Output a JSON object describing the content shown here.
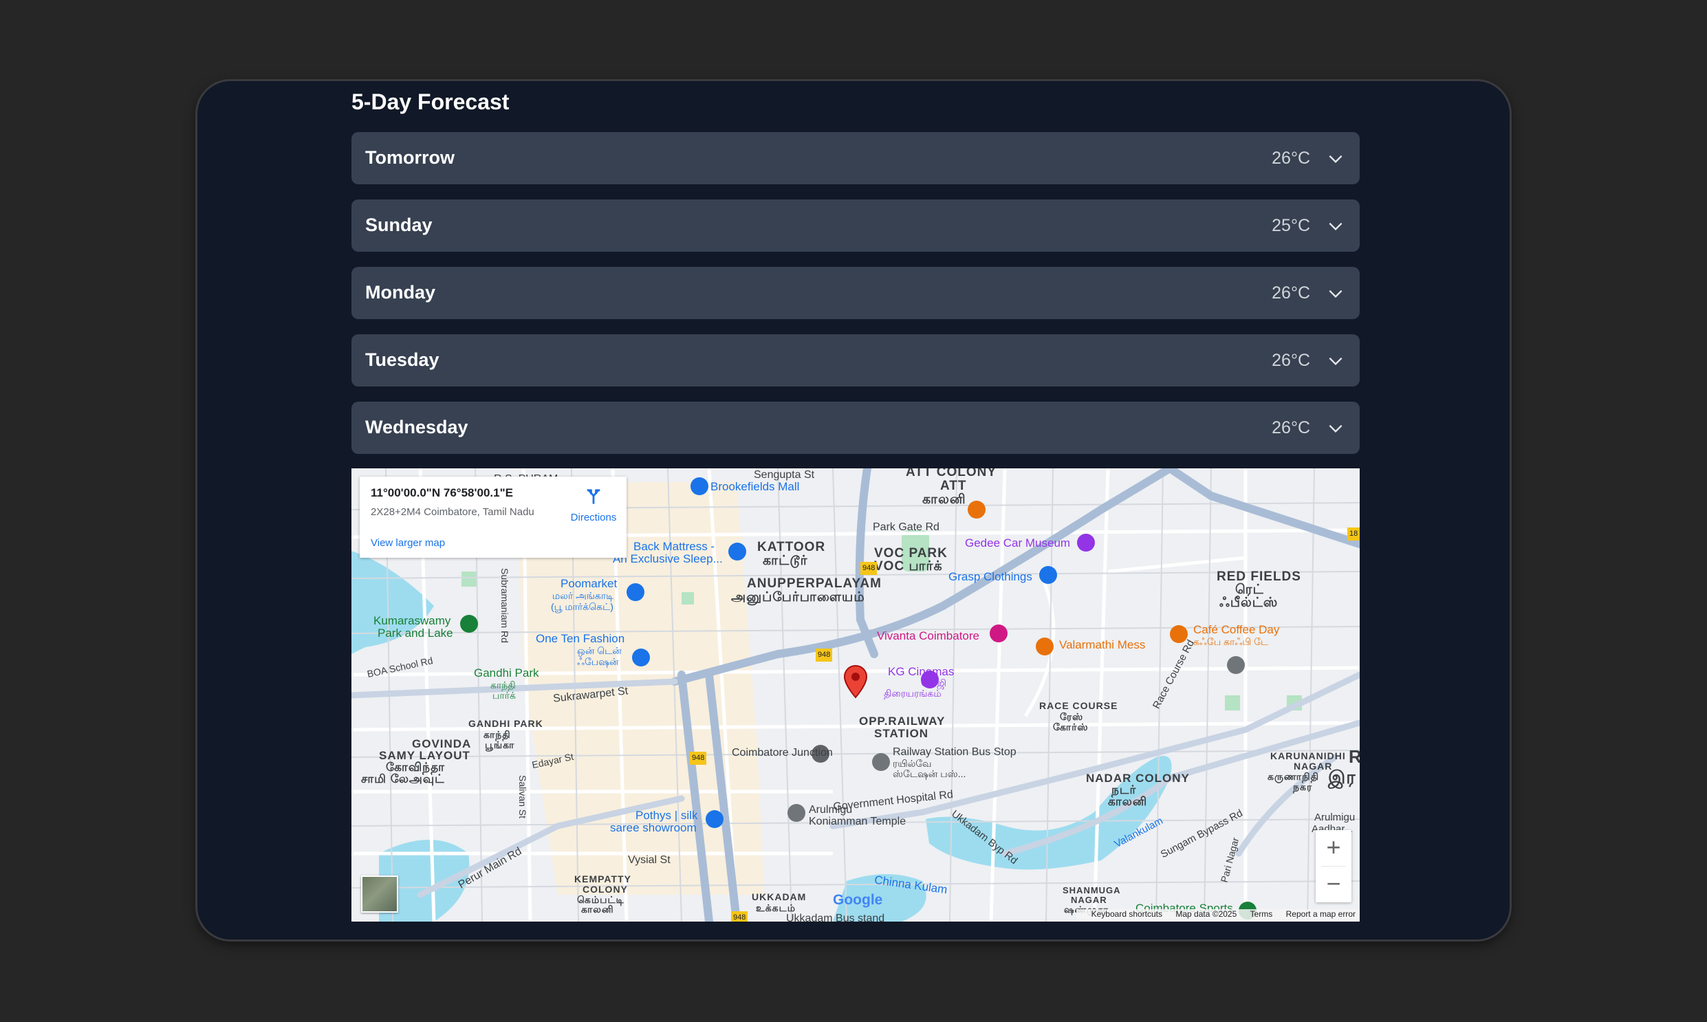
{
  "forecast": {
    "title": "5-Day Forecast",
    "days": [
      {
        "name": "Tomorrow",
        "temp": "26°C"
      },
      {
        "name": "Sunday",
        "temp": "25°C"
      },
      {
        "name": "Monday",
        "temp": "26°C"
      },
      {
        "name": "Tuesday",
        "temp": "26°C"
      },
      {
        "name": "Wednesday",
        "temp": "26°C"
      }
    ]
  },
  "map": {
    "info": {
      "coords": "11°00'00.0\"N 76°58'00.1\"E",
      "address": "2X28+2M4 Coimbatore, Tamil Nadu",
      "view_larger": "View larger map",
      "directions": "Directions"
    },
    "labels": {
      "brookefields": "Brookefields Mall",
      "kattoor": "KATTOOR",
      "kattoor_ta": "காட்டூர்",
      "anupperpalayam": "ANUPPERPALAYAM",
      "anupperpalayam_ta": "அனுப்பேர்பாளையம்",
      "att_colony": "ATT COLONY",
      "att": "ATT",
      "att_ta": "காலனி",
      "park_gate": "Park Gate Rd",
      "voc_park": "VOC PARK",
      "voc_park_ta": "VOC பார்க்",
      "gedee": "Gedee Car Museum",
      "grasp": "Grasp Clothings",
      "red_fields": "RED FIELDS",
      "red_fields_ta1": "ரெட்",
      "red_fields_ta2": "ஃபீல்ட்ஸ்",
      "back_mattress": "Back Mattress -",
      "back_mattress2": "An Exclusive Sleep...",
      "poomarket": "Poomarket",
      "poomarket_ta": "மலர் அங்காடி",
      "poomarket_ta2": "(பூ மார்க்கெட்)",
      "kumaraswamy": "Kumaraswamy",
      "kumaraswamy2": "Park and Lake",
      "one_ten": "One Ten Fashion",
      "one_ten_ta": "ஒன் டென்",
      "one_ten_ta2": "ஃபேஷன்",
      "vivanta": "Vivanta Coimbatore",
      "valarmathi": "Valarmathi Mess",
      "cafe_coffee": "Café Coffee Day",
      "cafe_coffee_ta": "கஃபே காஃபி டே",
      "kg_cinemas": "KG Cinemas",
      "kg_cinemas_ta": "கே.ஜி",
      "kg_cinemas_ta2": "திரையரங்கம்",
      "gandhi_park": "Gandhi Park",
      "gandhi_park_ta": "காந்தி",
      "gandhi_park_ta2": "பார்க்",
      "sukrawarpet": "Sukrawarpet St",
      "gandhi_park_area": "GANDHI PARK",
      "gandhi_park_area_ta": "காந்தி",
      "gandhi_park_area_ta2": "பூங்கா",
      "govinda": "GOVINDA",
      "samy": "SAMY LAYOUT",
      "govinda_ta": "கோவிந்தா",
      "samy_ta": "சாமி லேஅவுட்",
      "opp_railway": "OPP.RAILWAY",
      "station": "STATION",
      "race_course": "RACE COURSE",
      "race_course_ta": "ரேஸ்",
      "race_course_ta2": "கோர்ஸ்",
      "coimbatore_jn": "Coimbatore Junction",
      "railway_bus": "Railway Station Bus Stop",
      "railway_bus_ta": "ரயில்வே",
      "railway_bus_ta2": "ஸ்டேஷன் பஸ்...",
      "nadar": "NADAR COLONY",
      "nadar_ta": "நடர்",
      "nadar_ta2": "காலனி",
      "karunanidhi": "KARUNANIDHI",
      "karunanidhi2": "NAGAR",
      "karunanidhi_ta": "கருணாநிதி",
      "karunanidhi_ta2": "நகர",
      "edayar": "Edayar St",
      "subramaniam": "Subramaniam Rd",
      "salivan": "Salivan St",
      "boa_school": "BOA School Rd",
      "govt_hospital": "Government Hospital Rd",
      "race_course_rd": "Race Course Rd",
      "pothys": "Pothys | silk",
      "pothys2": "saree showroom",
      "arulmigu": "Arulmigu",
      "koniamman": "Koniamman Temple",
      "ukkadam_byp": "Ukkadam Byp Rd",
      "valankulam": "Valankulam",
      "sungam": "Sungam Bypass Rd",
      "vysial": "Vysial St",
      "perur": "Perur Main Rd",
      "kempatty": "KEMPATTY",
      "colony": "COLONY",
      "kempatty_ta": "கெம்பட்டி",
      "kempatty_ta2": "காலனி",
      "ukkadam": "UKKADAM",
      "ukkadam_ta": "உக்கடம்",
      "ukkadam_bus": "Ukkadam Bus stand",
      "chinna_kulam": "Chinna Kulam",
      "shanmuga": "SHANMUGA",
      "shanmuga2": "NAGAR",
      "shanmuga_ta": "ஷண்முகா",
      "coimbatore_sports": "Coimbatore Sports",
      "sengupta": "Sengupta St",
      "rs_puram": "R.S. PURAM",
      "arulmigu_r": "Arulmigu",
      "aadhar": "Aadhar...",
      "ram": "Ran",
      "ram_ta": "இர",
      "park_nagar": "Pari Nagar",
      "road_948": "948",
      "road_18": "18"
    },
    "zoom_in": "+",
    "zoom_out": "−",
    "google": "Google",
    "attribution": {
      "shortcuts": "Keyboard shortcuts",
      "mapdata": "Map data ©2025",
      "terms": "Terms",
      "report": "Report a map error"
    }
  }
}
